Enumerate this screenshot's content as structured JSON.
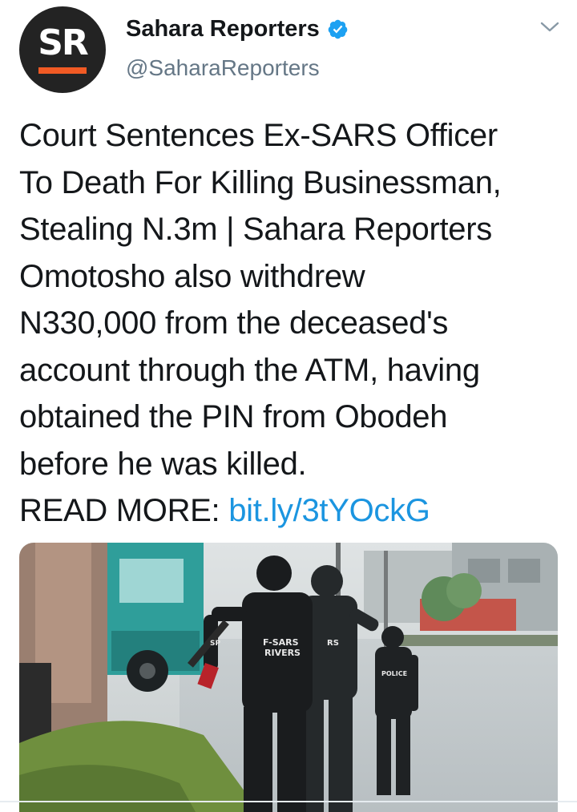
{
  "author": {
    "avatar_initials": "SR",
    "name": "Sahara Reporters",
    "handle": "@SaharaReporters",
    "verified_icon": "verified-badge-icon",
    "accent_color": "#1da1f2",
    "avatar_bar_color": "#f15a24"
  },
  "menu_icon": "chevron-down-icon",
  "tweet": {
    "body": "Court Sentences Ex-SARS Officer\nTo Death For Killing Businessman,\nStealing N.3m | Sahara Reporters\nOmotosho also withdrew\nN330,000 from the deceased's\naccount through the ATM, having\nobtained the PIN from Obodeh\nbefore he was killed.",
    "read_more_label": "READ MORE: ",
    "link_text": "bit.ly/3tYOckG",
    "link_color": "#1b95e0"
  },
  "media": {
    "vest_label_line1": "F-SARS",
    "vest_label_line2": "RIVERS",
    "sleeve_label_left": "SP",
    "sleeve_label_right": "RS",
    "back_label": "POLICE"
  }
}
